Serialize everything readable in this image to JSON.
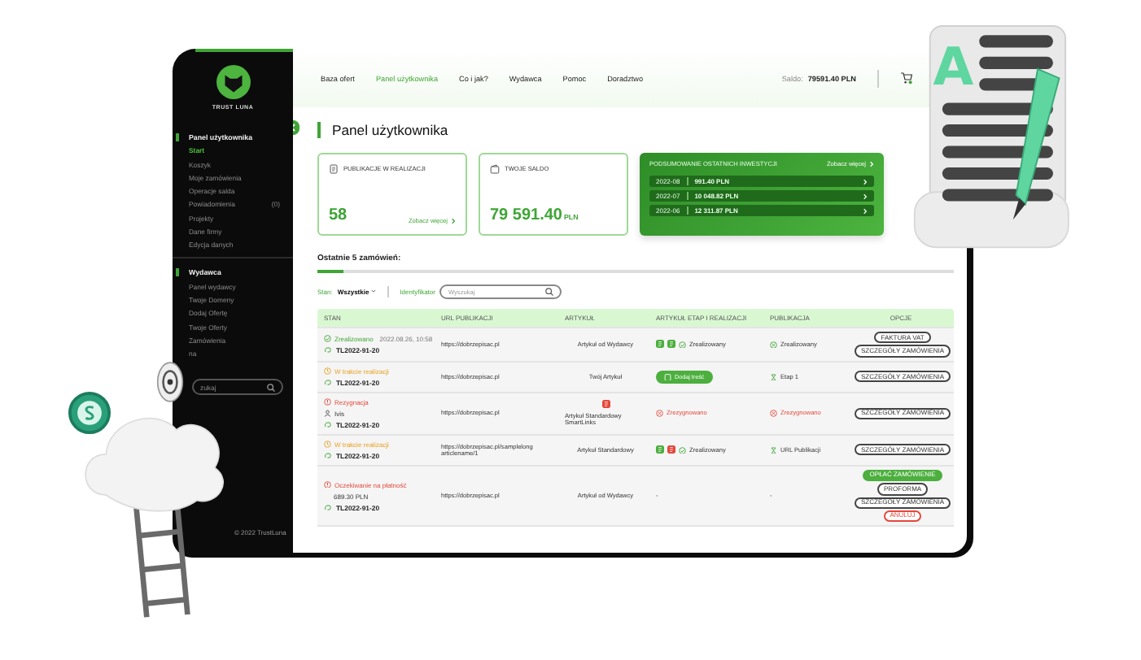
{
  "decorations": {
    "document_letter": "A"
  },
  "sidebar": {
    "logo_text": "TRUST LUNA",
    "groups": [
      {
        "title": "Panel użytkownika",
        "items": [
          {
            "label": "Start",
            "selected": true
          },
          {
            "label": "Koszyk",
            "selected": false
          },
          {
            "label": "Moje zamówienia",
            "selected": false
          },
          {
            "label": "Operacje salda",
            "selected": false
          },
          {
            "label": "Powiadomienia",
            "badge": "(0)",
            "selected": false
          },
          {
            "label": "Projekty",
            "selected": false
          },
          {
            "label": "Dane firmy",
            "selected": false
          },
          {
            "label": "Edycja danych",
            "selected": false
          }
        ]
      },
      {
        "title": "Wydawca",
        "items": [
          {
            "label": "Panel wydawcy",
            "selected": false
          },
          {
            "label": "Twoje Domeny",
            "selected": false
          },
          {
            "label": "Dodaj Ofertę",
            "selected": false
          },
          {
            "label": "Twoje Oferty",
            "selected": false
          },
          {
            "label": "Zamówienia",
            "selected": false
          },
          {
            "label": "na",
            "selected": false
          }
        ]
      }
    ],
    "search_placeholder": "zukaj",
    "footer": "© 2022 TrustLuna"
  },
  "nav": {
    "items": [
      {
        "label": "Baza ofert",
        "selected": false
      },
      {
        "label": "Panel użytkownika",
        "selected": true
      },
      {
        "label": "Co i jak?",
        "selected": false
      },
      {
        "label": "Wydawca",
        "selected": false
      },
      {
        "label": "Pomoc",
        "selected": false
      },
      {
        "label": "Doradztwo",
        "selected": false
      }
    ],
    "balance_label": "Saldo:",
    "balance_value": "79591.40 PLN"
  },
  "page_title": "Panel użytkownika",
  "cards": [
    {
      "kind": "publications",
      "title": "PUBLIKACJE W REALIZACJI",
      "value": "58",
      "link": "Zobacz więcej"
    },
    {
      "kind": "balance",
      "title": "TWOJE SALDO",
      "value": "79 591.40",
      "unit": "PLN"
    }
  ],
  "investments": {
    "title": "PODSUMOWANIE OSTATNICH INWESTYCJI",
    "link": "Zobacz więcej",
    "rows": [
      {
        "month": "2022-08",
        "amount": "991.40",
        "unit": "PLN"
      },
      {
        "month": "2022-07",
        "amount": "10 048.82",
        "unit": "PLN"
      },
      {
        "month": "2022-06",
        "amount": "12 311.87",
        "unit": "PLN"
      }
    ]
  },
  "orders": {
    "title": "Ostatnie 5 zamówień:",
    "filter_label": "Stan:",
    "filter_value": "Wszystkie",
    "search_label": "Identyfikator",
    "search_placeholder": "Wyszukaj",
    "columns": [
      "STAN",
      "URL PUBLIKACJI",
      "ARTYKUŁ",
      "ARTYKUŁ ETAP I REALIZACJI",
      "PUBLIKACJA",
      "OPCJE"
    ],
    "rows": [
      {
        "status": {
          "kind": "done",
          "label": "Zrealizowano",
          "date": "2022.08.26, 10:58"
        },
        "id": "TL2022-91-20",
        "url": "https://dobrzepisac.pl",
        "article": {
          "text": "Artykuł od Wydawcy"
        },
        "stage": {
          "kind": "status",
          "icons": [
            {
              "color": "#4caf3e"
            },
            {
              "color": "#4caf3e"
            }
          ],
          "label": "Zrealizowany"
        },
        "publication": {
          "kind": "done",
          "label": "Zrealizowany"
        },
        "options": [
          {
            "kind": "outline",
            "label": "FAKTURA VAT"
          },
          {
            "kind": "outline",
            "label": "SZCZEGÓŁY ZAMÓWIENIA"
          }
        ]
      },
      {
        "status": {
          "kind": "progress",
          "label": "W trakcie realizacji"
        },
        "id": "TL2022-91-20",
        "url": "https://dobrzepisac.pl",
        "article": {
          "text": "Twój Artykuł"
        },
        "stage": {
          "kind": "button",
          "label": "Dodaj treść"
        },
        "publication": {
          "kind": "waiting",
          "label": "Etap 1"
        },
        "options": [
          {
            "kind": "outline",
            "label": "SZCZEGÓŁY ZAMÓWIENIA"
          }
        ]
      },
      {
        "status": {
          "kind": "cancelled",
          "label": "Rezygnacja",
          "person": "Ivis"
        },
        "id": "TL2022-91-20",
        "url": "https://dobrzepisac.pl",
        "article": {
          "text": "Artykuł Standardowy SmartLinks",
          "has_icon": true
        },
        "stage": {
          "kind": "cancelled",
          "label": "Zrezygnowano"
        },
        "publication": {
          "kind": "cancelled",
          "label": "Zrezygnowano"
        },
        "options": [
          {
            "kind": "outline",
            "label": "SZCZEGÓŁY ZAMÓWIENIA"
          }
        ]
      },
      {
        "status": {
          "kind": "progress",
          "label": "W trakcie realizacji"
        },
        "id": "TL2022-91-20",
        "url": "https://dobrzepisac.pl/samplelong articlename/1",
        "article": {
          "text": "Artykuł Standardowy"
        },
        "stage": {
          "kind": "status",
          "icons": [
            {
              "color": "#4caf3e"
            },
            {
              "color": "#e5473b"
            }
          ],
          "label": "Zrealizowany"
        },
        "publication": {
          "kind": "waiting",
          "label": "URL Publikacji"
        },
        "options": [
          {
            "kind": "outline",
            "label": "SZCZEGÓŁY ZAMÓWIENIA"
          }
        ]
      },
      {
        "status": {
          "kind": "payment",
          "label": "Oczekiwanie na płatność",
          "amount": "689.30 PLN"
        },
        "id": "TL2022-91-20",
        "url": "https://dobrzepisac.pl",
        "article": {
          "text": "Artykuł od Wydawcy"
        },
        "stage": {
          "kind": "none",
          "label": "-"
        },
        "publication": {
          "kind": "none",
          "label": "-"
        },
        "options": [
          {
            "kind": "primary",
            "label": "OPŁAĆ ZAMÓWIENIE"
          },
          {
            "kind": "outline",
            "label": "PROFORMA"
          },
          {
            "kind": "outline",
            "label": "SZCZEGÓŁY ZAMÓWIENIA"
          },
          {
            "kind": "danger",
            "label": "ANULUJ"
          }
        ]
      }
    ]
  }
}
